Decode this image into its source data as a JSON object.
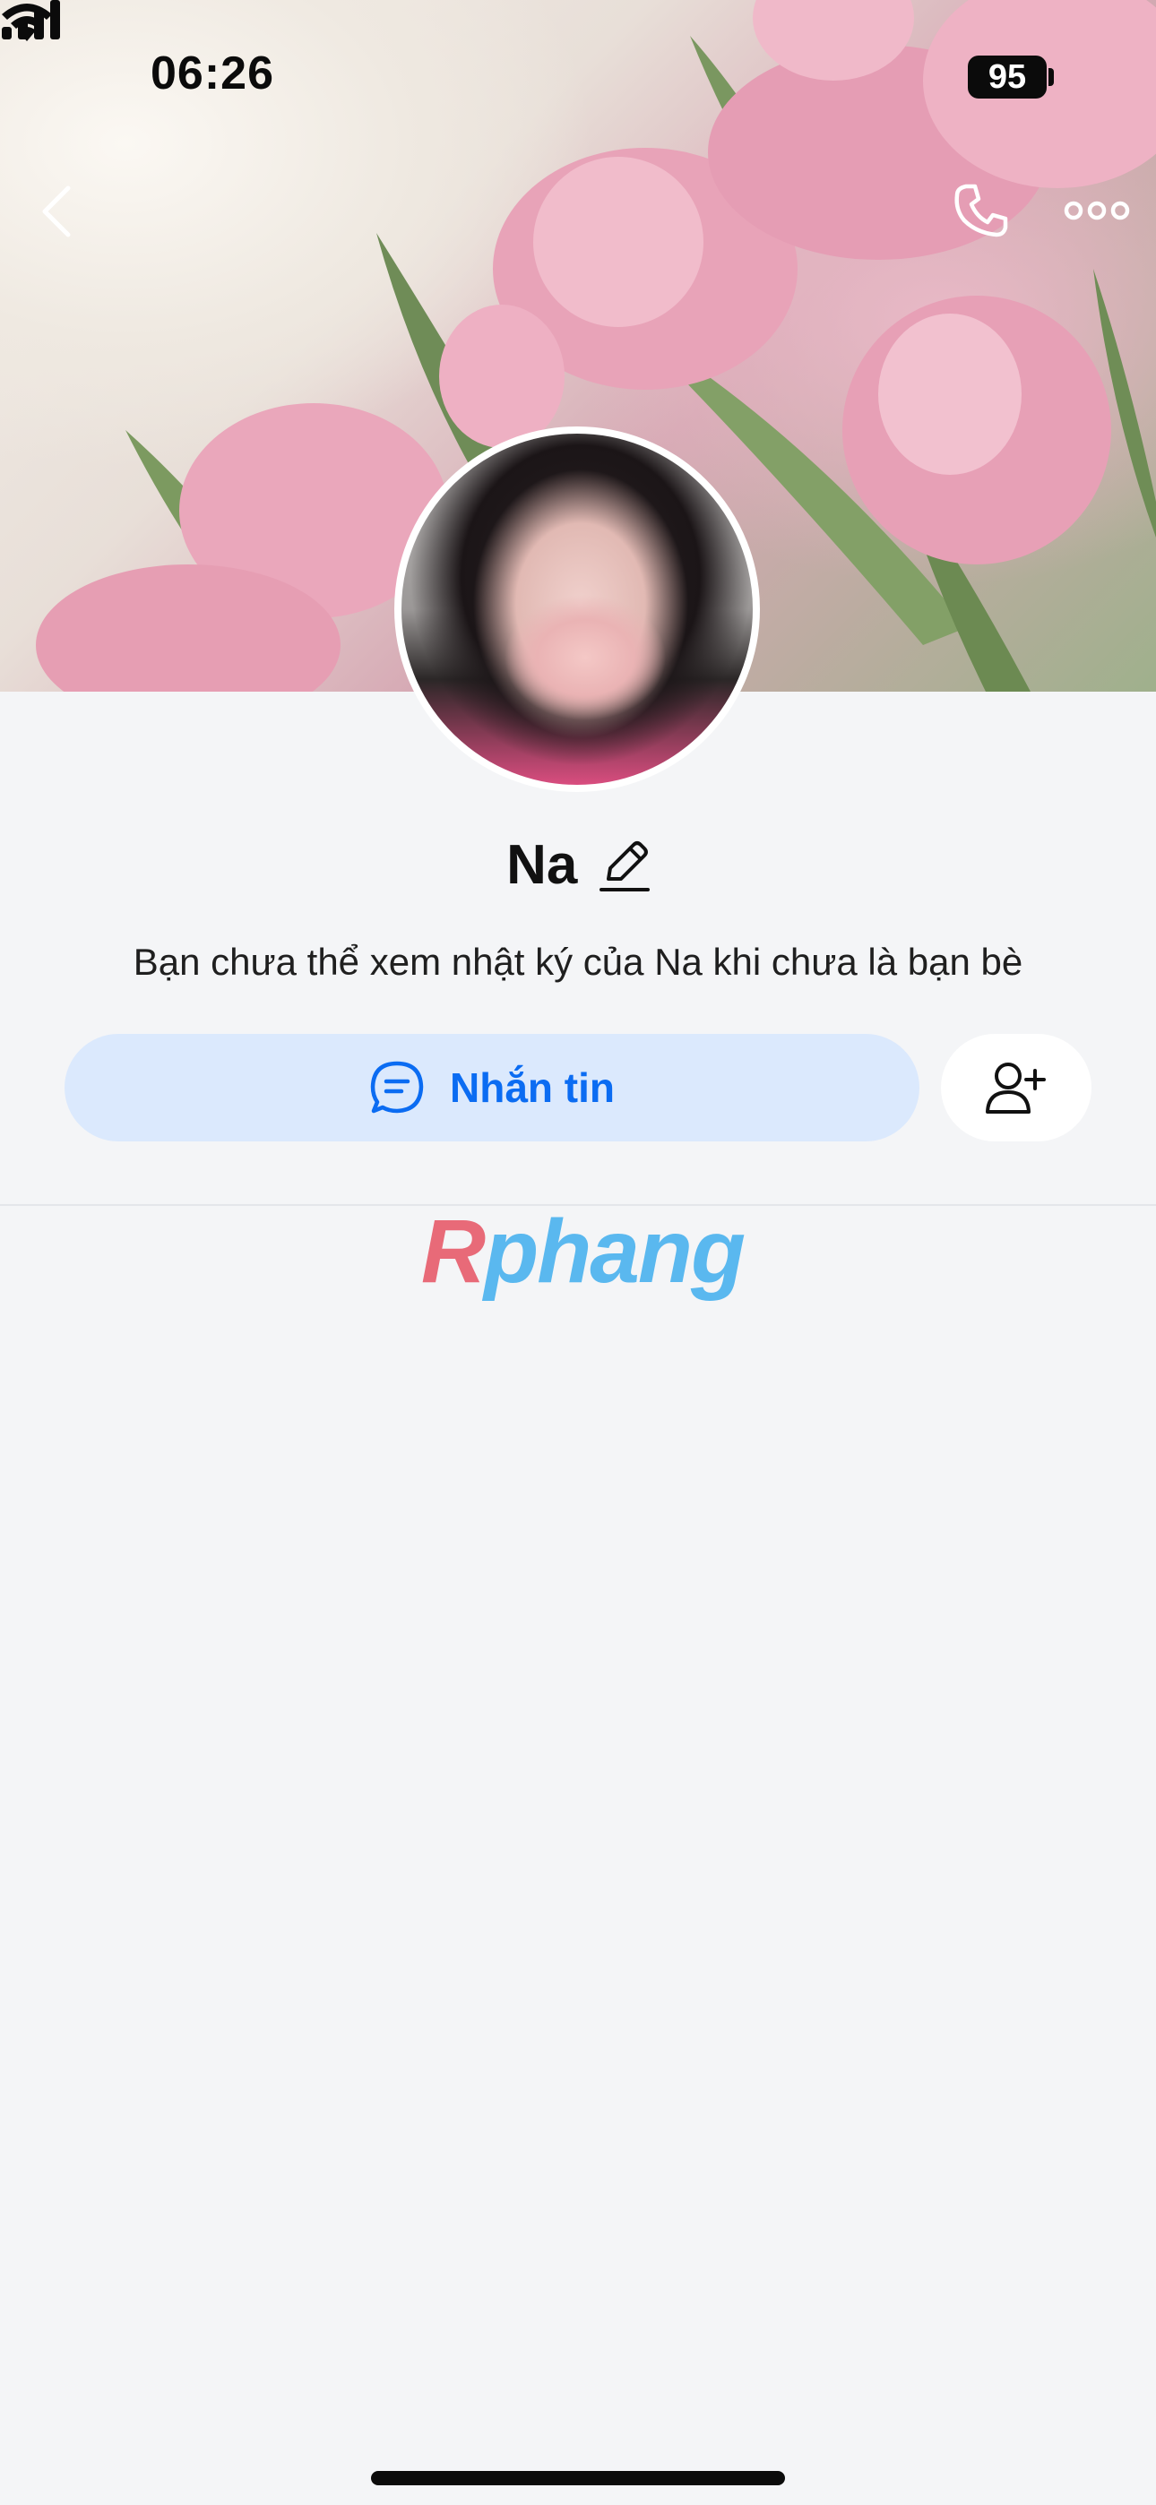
{
  "status_bar": {
    "time": "06:26",
    "battery": "95",
    "icons": [
      "cellular-signal-icon",
      "wifi-icon",
      "battery-icon"
    ]
  },
  "nav": {
    "back_icon": "chevron-left-icon",
    "call_icon": "phone-icon",
    "more_icon": "more-horizontal-icon"
  },
  "profile": {
    "name": "Na",
    "edit_icon": "pencil-icon",
    "subtitle": "Bạn chưa thể xem nhật ký của Na khi chưa là bạn bè"
  },
  "actions": {
    "message_label": "Nhắn tin",
    "message_icon": "chat-bubble-icon",
    "add_friend_icon": "add-user-icon"
  },
  "watermark": {
    "first": "R",
    "rest": "phang"
  },
  "colors": {
    "accent": "#0b6cf2",
    "message_bg": "#dbe9fd",
    "page_bg": "#f4f5f7"
  }
}
